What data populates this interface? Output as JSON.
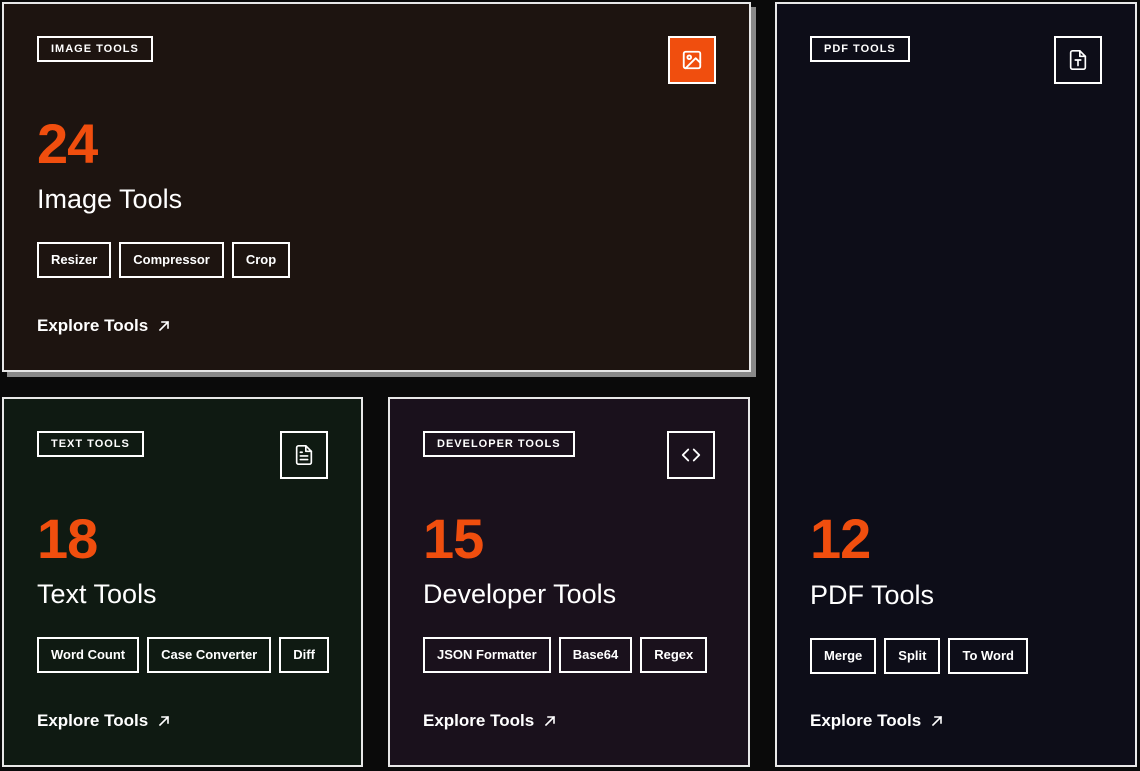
{
  "cards": {
    "image": {
      "tag": "IMAGE TOOLS",
      "count": "24",
      "title": "Image Tools",
      "chips": [
        "Resizer",
        "Compressor",
        "Crop"
      ],
      "cta": "Explore Tools",
      "icon": "image-icon"
    },
    "text": {
      "tag": "TEXT TOOLS",
      "count": "18",
      "title": "Text Tools",
      "chips": [
        "Word Count",
        "Case Converter",
        "Diff"
      ],
      "cta": "Explore Tools",
      "icon": "document-icon"
    },
    "developer": {
      "tag": "DEVELOPER TOOLS",
      "count": "15",
      "title": "Developer Tools",
      "chips": [
        "JSON Formatter",
        "Base64",
        "Regex"
      ],
      "cta": "Explore Tools",
      "icon": "code-icon"
    },
    "pdf": {
      "tag": "PDF TOOLS",
      "count": "12",
      "title": "PDF Tools",
      "chips": [
        "Merge",
        "Split",
        "To Word"
      ],
      "cta": "Explore Tools",
      "icon": "pdf-file-icon"
    }
  },
  "colors": {
    "accent": "#f04e0e",
    "page_bg": "#0a0a0a",
    "image_card_bg": "#1d1410",
    "text_card_bg": "#0f1a12",
    "developer_card_bg": "#1a111c",
    "pdf_card_bg": "#0d0d18"
  }
}
